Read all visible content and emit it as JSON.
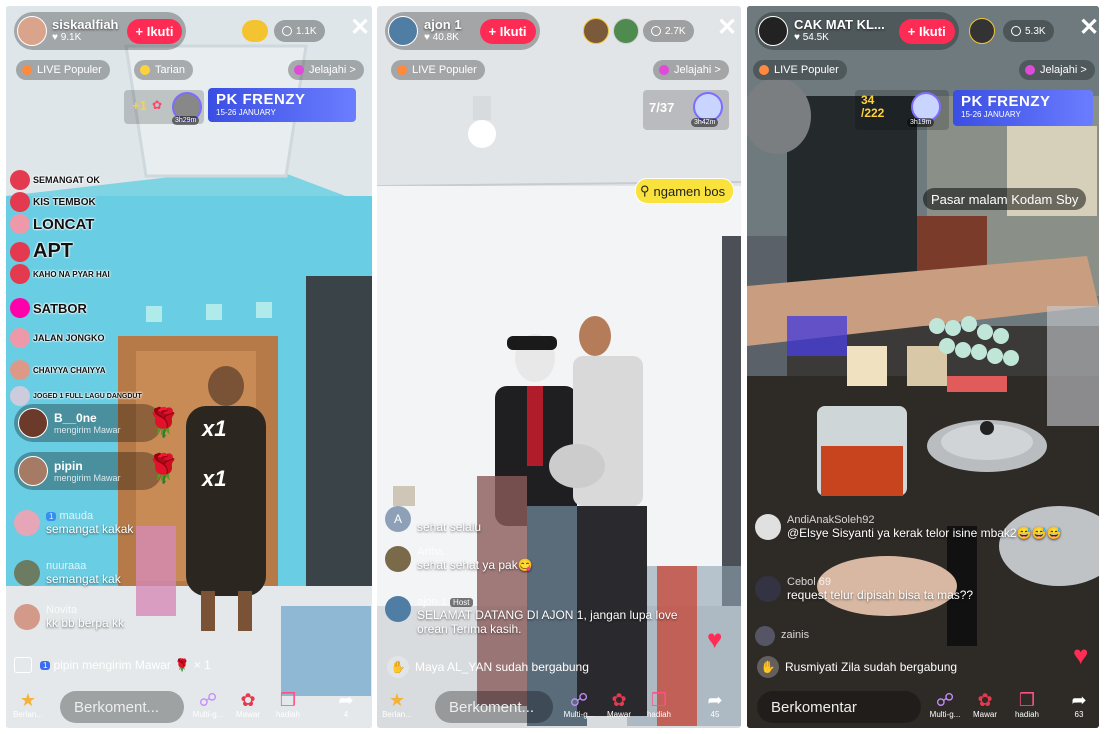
{
  "panels": [
    {
      "host": {
        "name": "siskaalfiah",
        "likes": "9.1K"
      },
      "follow": "+ Ikuti",
      "viewers": "1.1K",
      "chips": [
        "LIVE Populer",
        "Tarian",
        "Jelajahi >"
      ],
      "pk": {
        "title": "PK FRENZY",
        "dates": "15-26 JANUARY",
        "timer": "3h29m",
        "score": "+1"
      },
      "stickers": [
        "SEMANGAT OK",
        "KIS TEMBOK",
        "LONCAT",
        "APT",
        "KAHO NA PYAR HAI",
        "SATBOR",
        "JALAN JONGKO",
        "CHAIYYA CHAIYYA",
        "JOGED 1 FULL LAGU DANGDUT"
      ],
      "gifts": [
        {
          "user": "B__0ne",
          "action": "mengirim Mawar",
          "count": "x1"
        },
        {
          "user": "pipin",
          "action": "mengirim Mawar",
          "count": "x1"
        }
      ],
      "comments": [
        {
          "level": "1",
          "user": "mauda",
          "text": "semangat kakak"
        },
        {
          "user": "nuuraaa",
          "text": "semangat kak"
        },
        {
          "user": "Novita",
          "text": "kk bb berpa kk"
        }
      ],
      "ticker": {
        "level": "1",
        "text": "pipin mengirim Mawar",
        "count": "× 1"
      },
      "input_placeholder": "Berkoment...",
      "bottom": [
        "Berlan...",
        "Multi-g...",
        "Mawar",
        "hadiah",
        "4"
      ]
    },
    {
      "host": {
        "name": "ajon 1",
        "likes": "40.8K"
      },
      "follow": "+ Ikuti",
      "viewers": "2.7K",
      "chips": [
        "LIVE Populer",
        "Jelajahi >"
      ],
      "pk": {
        "score": "7/37",
        "timer": "3h42m"
      },
      "tag": "ngamen bos",
      "comments": [
        {
          "user": "A",
          "text": "sehat selalu"
        },
        {
          "user": "Artha",
          "text": "sehat sehat ya pak😋"
        },
        {
          "user": "ajon 1",
          "badge": "Host",
          "text": "SELAMAT DATANG DI AJON 1, jangan lupa love orean Terima kasih."
        }
      ],
      "join": "Maya AL_YAN sudah bergabung",
      "input_placeholder": "Berkoment...",
      "bottom": [
        "Berlan...",
        "Multi-g...",
        "Mawar",
        "hadiah",
        "45"
      ]
    },
    {
      "host": {
        "name": "CAK MAT KL...",
        "likes": "54.5K"
      },
      "follow": "+ Ikuti",
      "viewers": "5.3K",
      "chips": [
        "LIVE Populer",
        "Jelajahi >"
      ],
      "pk": {
        "title": "PK FRENZY",
        "dates": "15-26 JANUARY",
        "timer": "3h19m",
        "score": "34\n/222"
      },
      "tag": "Pasar malam Kodam Sby",
      "comments": [
        {
          "user": "AndiAnakSoleh92",
          "text": "@Elsye Sisyanti ya kerak telor isine mbak2😅😅😅"
        },
        {
          "user": "Cebol 69",
          "text": "request telur dipisah bisa ta mas??"
        },
        {
          "user": "zainis",
          "text": ""
        }
      ],
      "join": "Rusmiyati Zila sudah bergabung",
      "input_placeholder": "Berkomentar",
      "bottom": [
        "Multi-g...",
        "Mawar",
        "hadiah",
        "63"
      ]
    }
  ],
  "colors": {
    "follow": "#fe2c55",
    "pk": "#3a4ee3",
    "rose": "#e33a4f"
  }
}
